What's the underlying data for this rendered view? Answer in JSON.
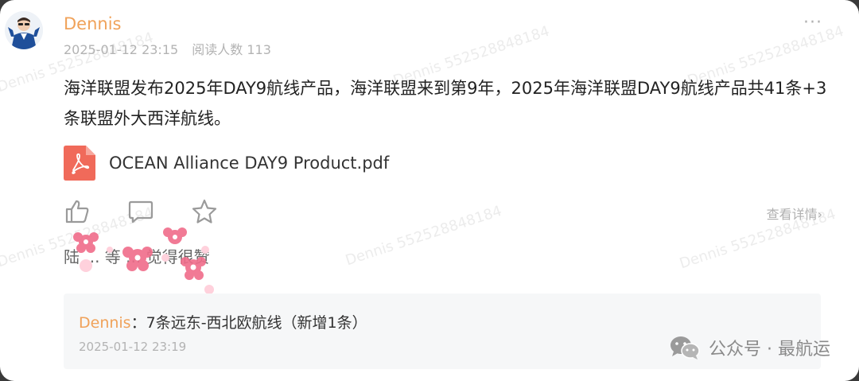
{
  "post": {
    "author": "Dennis",
    "date": "2025-01-12 23:15",
    "reads": "阅读人数 113",
    "more": "···",
    "text": "海洋联盟发布2025年DAY9航线产品，海洋联盟来到第9年，2025年海洋联盟DAY9航线产品共41条+3条联盟外大西洋航线。",
    "attachment": "OCEAN Alliance DAY9 Product.pdf",
    "details_link": "查看详情",
    "likes_text": "陆 ... 等 ... 觉得很赞"
  },
  "comment": {
    "author": "Dennis",
    "separator": "：",
    "text": "7条远东-西北欧航线（新增1条）",
    "time": "2025-01-12 23:19"
  },
  "brand": {
    "text": "公众号 · 最航运"
  },
  "watermark": {
    "text": "Dennis 5525288481​84"
  },
  "icons": {
    "like": "thumbs-up-icon",
    "comment": "comment-bubble-icon",
    "favorite": "star-icon",
    "pdf": "pdf-file-icon",
    "chevron": "chevron-right-icon",
    "wechat": "wechat-icon"
  },
  "colors": {
    "author": "#f0a25a",
    "pdf": "#f06a5a",
    "muted": "#b3b3b3"
  }
}
